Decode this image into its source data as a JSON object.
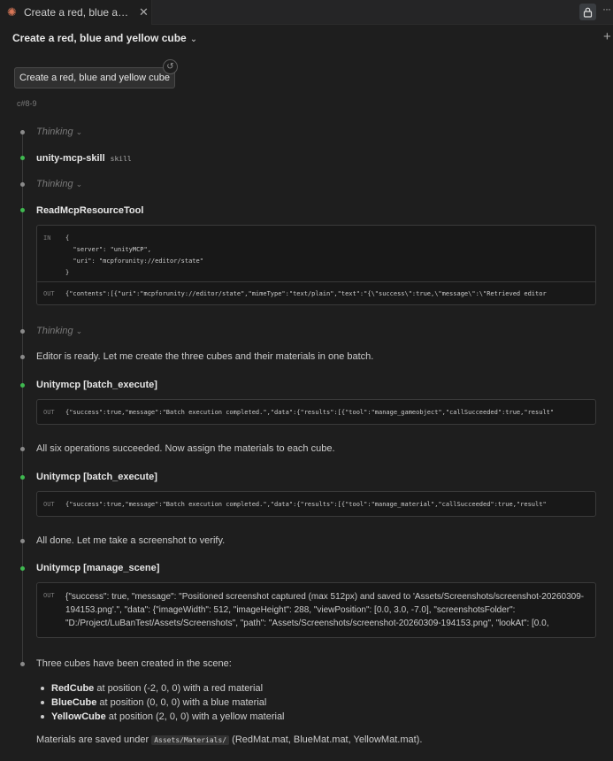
{
  "tab": {
    "title": "Create a red, blue and yellow cube",
    "close_icon": "✕"
  },
  "header": {
    "title": "Create a red, blue and yellow cube"
  },
  "user_message": "Create a red, blue and yellow cube",
  "checkpoint": "c#8-9",
  "thinking_label": "Thinking",
  "step1": {
    "title": "unity-mcp-skill",
    "tag": "skill"
  },
  "step2": {
    "title": "ReadMcpResourceTool",
    "in_label": "IN",
    "in_lines": [
      "{",
      "  \"server\": \"unityMCP\",",
      "  \"uri\": \"mcpforunity://editor/state\"",
      "}"
    ],
    "out_label": "OUT",
    "out_text": "{\"contents\":[{\"uri\":\"mcpforunity://editor/state\",\"mimeType\":\"text/plain\",\"text\":\"{\\\"success\\\":true,\\\"message\\\":\\\"Retrieved editor"
  },
  "msg1": "Editor is ready. Let me create the three cubes and their materials in one batch.",
  "step3": {
    "title": "Unitymcp [batch_execute]",
    "out_label": "OUT",
    "out_text": "{\"success\":true,\"message\":\"Batch execution completed.\",\"data\":{\"results\":[{\"tool\":\"manage_gameobject\",\"callSucceeded\":true,\"result\""
  },
  "msg2": "All six operations succeeded. Now assign the materials to each cube.",
  "step4": {
    "title": "Unitymcp [batch_execute]",
    "out_label": "OUT",
    "out_text": "{\"success\":true,\"message\":\"Batch execution completed.\",\"data\":{\"results\":[{\"tool\":\"manage_material\",\"callSucceeded\":true,\"result\""
  },
  "msg3": "All done. Let me take a screenshot to verify.",
  "step5": {
    "title": "Unitymcp [manage_scene]",
    "out_label": "OUT",
    "out_text": "{\"success\": true, \"message\": \"Positioned screenshot captured (max 512px) and saved to 'Assets/Screenshots/screenshot-20260309-194153.png'.\", \"data\": {\"imageWidth\": 512, \"imageHeight\": 288, \"viewPosition\": [0.0, 3.0, -7.0], \"screenshotsFolder\": \"D:/Project/LuBanTest/Assets/Screenshots\", \"path\": \"Assets/Screenshots/screenshot-20260309-194153.png\", \"lookAt\": [0.0,"
  },
  "summary": {
    "intro": "Three cubes have been created in the scene:",
    "items": [
      {
        "name": "RedCube",
        "rest": " at position (-2, 0, 0) with a red material"
      },
      {
        "name": "BlueCube",
        "rest": " at position (0, 0, 0) with a blue material"
      },
      {
        "name": "YellowCube",
        "rest": " at position (2, 0, 0) with a yellow material"
      }
    ],
    "materials_prefix": "Materials are saved under ",
    "materials_path": "Assets/Materials/",
    "materials_suffix": " (RedMat.mat, BlueMat.mat, YellowMat.mat)."
  },
  "colors": {
    "success": "#3fb950",
    "accent": "#d97757",
    "background": "#1e1e1e"
  },
  "icons": {
    "tab": "claude-spark-icon",
    "lock": "lock-icon",
    "more": "more-icon",
    "new_chat": "plus-icon",
    "restore": "restore-icon",
    "expand": "chevron-down-icon"
  }
}
